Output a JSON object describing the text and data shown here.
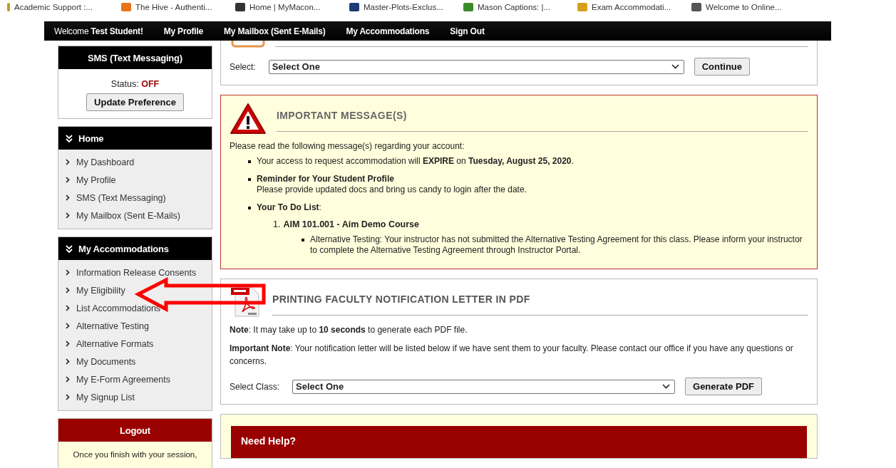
{
  "bookmarks": [
    "Academic Support :...",
    "The Hive - Authenti...",
    "Home | MyMacon...",
    "Master-Plots-Exclus...",
    "Mason Captions: |...",
    "Exam Accommodati...",
    "Welcome to Online..."
  ],
  "top_nav": {
    "welcome": "Welcome",
    "user": "Test Student!",
    "links": [
      "My Profile",
      "My Mailbox (Sent E-Mails)",
      "My Accommodations",
      "Sign Out"
    ]
  },
  "sms_panel": {
    "title": "SMS (Text Messaging)",
    "status_label": "Status:",
    "status_value": "OFF",
    "button": "Update Preference"
  },
  "menus": [
    {
      "title": "Home",
      "items": [
        "My Dashboard",
        "My Profile",
        "SMS (Text Messaging)",
        "My Mailbox (Sent E-Mails)"
      ]
    },
    {
      "title": "My Accommodations",
      "items": [
        "Information Release Consents",
        "My Eligibility",
        "List Accommodations",
        "Alternative Testing",
        "Alternative Formats",
        "My Documents",
        "My E-Form Agreements",
        "My Signup List"
      ]
    }
  ],
  "logout_panel": {
    "title": "Logout",
    "text": "Once you finish with your session,"
  },
  "select_panel": {
    "label": "Select:",
    "value": "Select One",
    "button": "Continue"
  },
  "important": {
    "title": "IMPORTANT MESSAGE(S)",
    "intro": "Please read the following message(s) regarding your account:",
    "messages": [
      {
        "kind": "text",
        "text": "Your access to request accommodation will **EXPIRE** on **Tuesday, August 25, 2020**."
      },
      {
        "kind": "titled",
        "title": "Reminder for Your Student Profile",
        "text": "Please provide updated docs and bring us candy to login after the date."
      },
      {
        "kind": "todo",
        "text": "**Your To Do List**:",
        "courses": [
          {
            "number": "1.",
            "title": "AIM 101.001 - Aim Demo Course",
            "notes": [
              "Alternative Testing: Your instructor has not submitted the Alternative Testing Agreement for this class. Please inform your instructor to complete the Alternative Testing Agreement through Instructor Portal."
            ]
          }
        ]
      }
    ]
  },
  "pdf_panel": {
    "title": "PRINTING FACULTY NOTIFICATION LETTER IN PDF",
    "notes": [
      "**Note**: It may take up to **10 seconds** to generate each PDF file.",
      "**Important Note**: Your notification letter will be listed below if we have sent them to your faculty. Please contact our office if you have any questions or concerns."
    ],
    "label": "Select Class:",
    "value": "Select One",
    "button": "Generate PDF"
  },
  "help_panel": {
    "title": "Need Help?"
  }
}
